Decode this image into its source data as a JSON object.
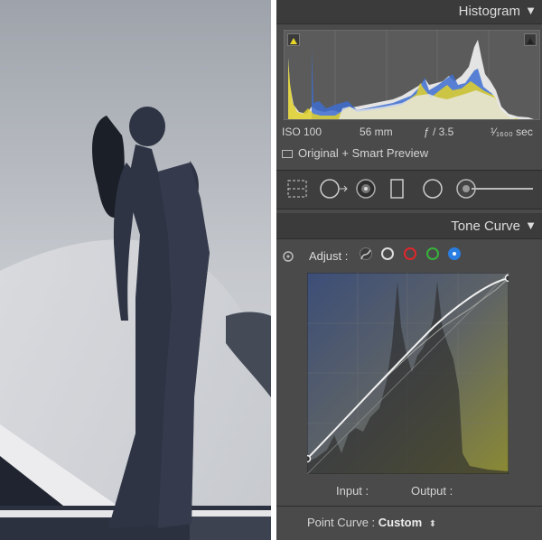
{
  "histogram_panel": {
    "title": "Histogram",
    "iso": "ISO 100",
    "focal_length": "56 mm",
    "aperture": "ƒ / 3.5",
    "shutter": "¹⁄₁₆₀₀ sec",
    "preview_status": "Original + Smart Preview"
  },
  "toolstrip": {
    "icons": [
      "crop-overlay-icon",
      "spot-removal-icon",
      "red-eye-icon",
      "graduated-filter-icon",
      "radial-filter-icon",
      "adjustment-brush-icon"
    ]
  },
  "tone_curve": {
    "title": "Tone Curve",
    "adjust_label": "Adjust :",
    "input_label": "Input :",
    "output_label": "Output :",
    "point_curve_label": "Point Curve :",
    "point_curve_value": "Custom",
    "channel_colors": {
      "rgb": "#dddddd",
      "red": "#e0262b",
      "green": "#37b33b",
      "blue": "#2a7de1"
    }
  }
}
